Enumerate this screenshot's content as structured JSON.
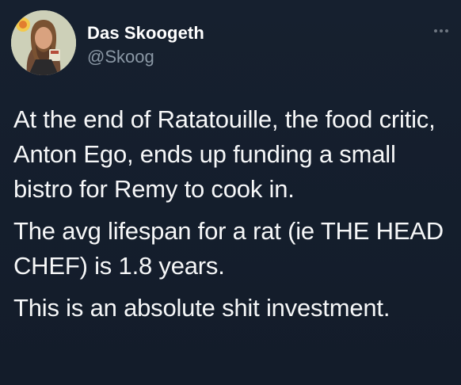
{
  "author": {
    "name": "Das Skoogeth",
    "handle": "@Skoog"
  },
  "icons": {
    "avatar": "profile-photo",
    "menu": "more-horizontal-icon"
  },
  "tweet": {
    "paragraphs": [
      "At the end of Ratatouille, the food critic, Anton Ego, ends up funding a small bistro for Remy to cook in.",
      "The avg lifespan for a rat (ie THE HEAD CHEF) is 1.8 years.",
      "This is an absolute shit investment."
    ]
  },
  "colors": {
    "background": "#141d2b",
    "text": "#f6f7f8",
    "secondary_text": "#8b98a5"
  }
}
